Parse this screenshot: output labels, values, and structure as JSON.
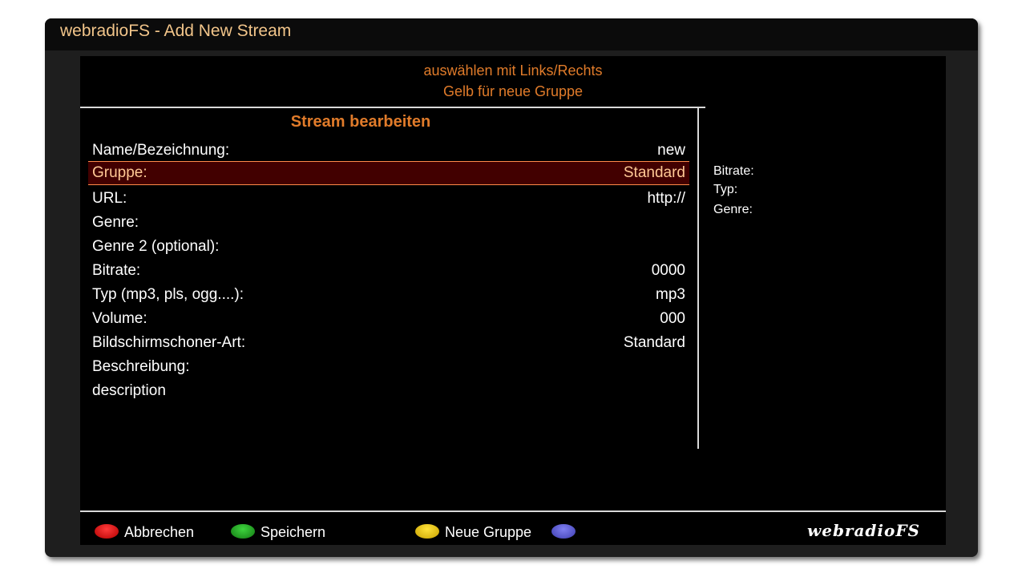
{
  "window": {
    "title": "webradioFS - Add New Stream"
  },
  "hints": {
    "line1": "auswählen mit Links/Rechts",
    "line2": "Gelb für neue Gruppe"
  },
  "form": {
    "title": "Stream bearbeiten",
    "fields": [
      {
        "label": "Name/Bezeichnung:",
        "value": "new"
      },
      {
        "label": "Gruppe:",
        "value": "Standard",
        "selected": true
      },
      {
        "label": "URL:",
        "value": "http://"
      },
      {
        "label": "Genre:",
        "value": ""
      },
      {
        "label": "Genre 2 (optional):",
        "value": ""
      },
      {
        "label": "Bitrate:",
        "value": "0000"
      },
      {
        "label": "Typ (mp3, pls, ogg....):",
        "value": "mp3"
      },
      {
        "label": "Volume:",
        "value": "000"
      },
      {
        "label": "Bildschirmschoner-Art:",
        "value": "Standard"
      },
      {
        "label": "Beschreibung:",
        "value": ""
      },
      {
        "label": "description",
        "value": ""
      }
    ]
  },
  "info": {
    "bitrate_label": "Bitrate:",
    "typ_label": "Typ:",
    "genre_label": "Genre:"
  },
  "footer": {
    "red": {
      "label": "Abbrechen",
      "color": "#d40000"
    },
    "green": {
      "label": "Speichern",
      "color": "#1e9a1e"
    },
    "yellow": {
      "label": "Neue Gruppe",
      "color": "#e6c000"
    },
    "blue": {
      "label": "",
      "color": "#5b5bd0"
    },
    "logo": "webradioFS"
  },
  "colors": {
    "accent": "#e07b2a",
    "title": "#f2c58a",
    "selected_bg": "#420000"
  }
}
